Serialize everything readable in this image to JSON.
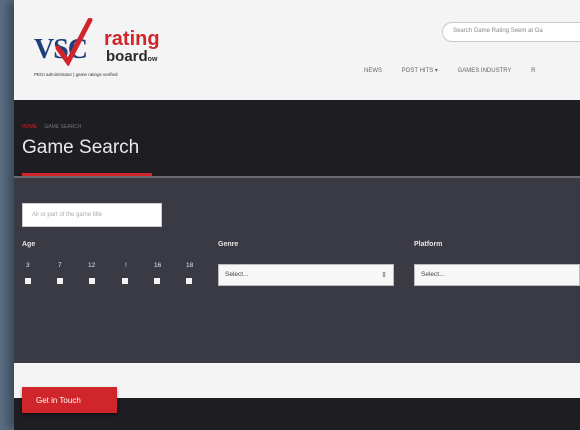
{
  "brand": {
    "vsc": "VSC",
    "rating": "rating",
    "board": "board",
    "board_suffix": "ow",
    "tagline": "PEGI administrator | game ratings verified"
  },
  "search": {
    "placeholder": "Search Game Rating Seem at Ga"
  },
  "nav": {
    "items": [
      "NEWS",
      "POST HITS ▾",
      "GAMES INDUSTRY",
      "R"
    ]
  },
  "breadcrumb": {
    "home": "HOME",
    "current": "GAME SEARCH"
  },
  "page": {
    "title": "Game Search"
  },
  "filters": {
    "title_placeholder": "All or part of the game title",
    "age_label": "Age",
    "ages": [
      "3",
      "7",
      "12",
      "!",
      "16",
      "18"
    ],
    "genre_label": "Genre",
    "genre_value": "Select...",
    "platform_label": "Platform",
    "platform_value": "Select..."
  },
  "cta": {
    "label": "Get in Touch"
  },
  "colors": {
    "accent": "#d0262b",
    "dark": "#1d1d22",
    "panel": "#3a3a44"
  }
}
